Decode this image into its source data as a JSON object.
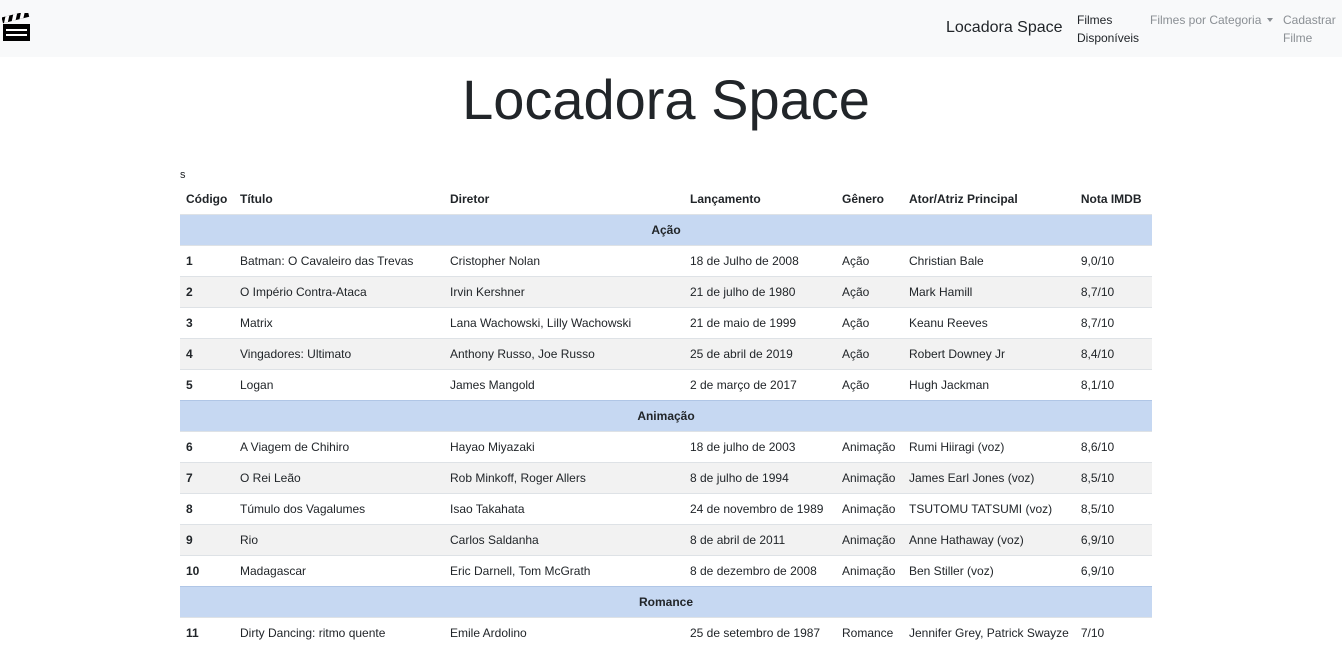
{
  "navbar": {
    "logo_icon": "clapperboard-icon",
    "brand": "Locadora Space",
    "links": {
      "filmes": "Filmes Disponíveis",
      "categoria": "Filmes por Categoria",
      "cadastrar": "Cadastrar Filme"
    }
  },
  "page": {
    "title": "Locadora Space",
    "stray_text": "s"
  },
  "table": {
    "headers": [
      "Código",
      "Título",
      "Diretor",
      "Lançamento",
      "Gênero",
      "Ator/Atriz Principal",
      "Nota IMDB"
    ],
    "groups": [
      {
        "name": "Ação",
        "rows": [
          [
            "1",
            "Batman: O Cavaleiro das Trevas",
            "Cristopher Nolan",
            "18 de Julho de 2008",
            "Ação",
            "Christian Bale",
            "9,0/10"
          ],
          [
            "2",
            "O Império Contra-Ataca",
            "Irvin Kershner",
            "21 de julho de 1980",
            "Ação",
            "Mark Hamill",
            "8,7/10"
          ],
          [
            "3",
            "Matrix",
            "Lana Wachowski, Lilly Wachowski",
            "21 de maio de 1999",
            "Ação",
            "Keanu Reeves",
            "8,7/10"
          ],
          [
            "4",
            "Vingadores: Ultimato",
            "Anthony Russo, Joe Russo",
            "25 de abril de 2019",
            "Ação",
            "Robert Downey Jr",
            "8,4/10"
          ],
          [
            "5",
            "Logan",
            "James Mangold",
            "2 de março de 2017",
            "Ação",
            "Hugh Jackman",
            "8,1/10"
          ]
        ]
      },
      {
        "name": "Animação",
        "rows": [
          [
            "6",
            "A Viagem de Chihiro",
            "Hayao Miyazaki",
            "18 de julho de 2003",
            "Animação",
            "Rumi Hiiragi (voz)",
            "8,6/10"
          ],
          [
            "7",
            "O Rei Leão",
            "Rob Minkoff, Roger Allers",
            "8 de julho de 1994",
            "Animação",
            "James Earl Jones (voz)",
            "8,5/10"
          ],
          [
            "8",
            "Túmulo dos Vagalumes",
            "Isao Takahata",
            "24 de novembro de 1989",
            "Animação",
            "TSUTOMU TATSUMI (voz)",
            "8,5/10"
          ],
          [
            "9",
            "Rio",
            "Carlos Saldanha",
            "8 de abril de 2011",
            "Animação",
            "Anne Hathaway (voz)",
            "6,9/10"
          ],
          [
            "10",
            "Madagascar",
            "Eric Darnell, Tom McGrath",
            "8 de dezembro de 2008",
            "Animação",
            "Ben Stiller (voz)",
            "6,9/10"
          ]
        ]
      },
      {
        "name": "Romance",
        "rows": [
          [
            "11",
            "Dirty Dancing: ritmo quente",
            "Emile Ardolino",
            "25 de setembro de 1987",
            "Romance",
            "Jennifer Grey, Patrick Swayze",
            "7/10"
          ]
        ]
      }
    ]
  }
}
